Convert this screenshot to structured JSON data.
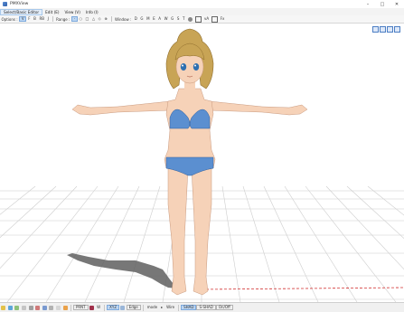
{
  "window": {
    "title": "PMXView",
    "minimize_glyph": "–",
    "maximize_glyph": "□",
    "close_glyph": "✕"
  },
  "menu": {
    "items": [
      {
        "label": "Select/Basic Editor"
      },
      {
        "label": "Edit (E)"
      },
      {
        "label": "View (V)"
      },
      {
        "label": "Info (I)"
      }
    ]
  },
  "toolbar": {
    "options_label": "Options :",
    "options": [
      "V",
      "F",
      "B",
      "RB",
      "J"
    ],
    "range_label": "Range :",
    "range_items": [
      "○",
      "□",
      "△",
      "◇",
      "⊕"
    ],
    "window_label": "Window :",
    "window_items": [
      "D",
      "G",
      "M",
      "E",
      "A",
      "W",
      "G",
      "S",
      "T"
    ],
    "extra_label": "vA",
    "fx_label": "Fx"
  },
  "status": {
    "print_label": "PRNT",
    "w_label": "W",
    "xyz_label": "XYZ",
    "edge_label": "Edge",
    "mode_label": "mode",
    "wire_label": "Wire",
    "shad_label": "SHAD",
    "sshad_label": "S-SHAD",
    "onoff_label": "On/Off"
  },
  "colors": {
    "accent": "#2f6fbd",
    "grid": "#c9c9c9",
    "skin": "#f6d2b8",
    "hair": "#c8a455",
    "bikini": "#5b8fd0",
    "shadow": "#5f5f5f",
    "axis_red": "#d23030"
  }
}
